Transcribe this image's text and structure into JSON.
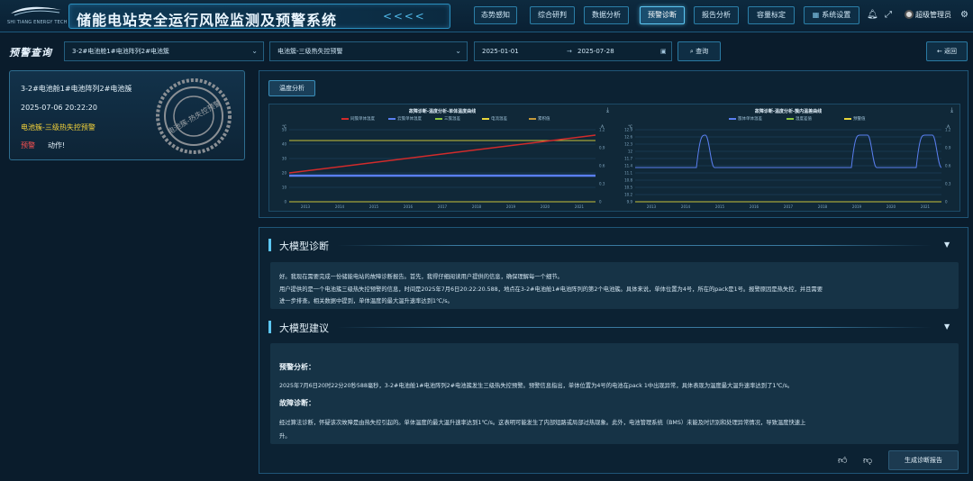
{
  "header": {
    "logo_text": "SHI TIANG ENERGY TECH 石 天 能 源",
    "title": "储能电站安全运行风险监测及预警系统",
    "arrows": "< < < <",
    "nav": [
      "态势感知",
      "综合研判",
      "数据分析",
      "预警诊断",
      "报告分析",
      "容量标定",
      "系统设置"
    ],
    "active_nav": "预警诊断",
    "user": "超级管理员"
  },
  "query": {
    "title": "预警查询",
    "target_select": "3-2#电池舱1#电池阵列2#电池簇",
    "warning_select": "电池簇-三级热失控预警",
    "date_start": "2025-01-01",
    "date_arrow": "→",
    "date_end": "2025-07-28",
    "search_label": "查询",
    "back_label": "返回"
  },
  "warning_card": {
    "location": "3-2#电池舱1#电池阵列2#电池簇",
    "time": "2025-07-06 20:22:20",
    "type": "电池簇-三级热失控预警",
    "level": "预警",
    "status": "动作!",
    "stamp_text": "电池簇-热失控预警"
  },
  "analysis": {
    "tab": "温度分析",
    "charts": [
      {
        "title": "故障诊断-温度分析-单体温度曲线",
        "left_unit": "℃",
        "right_unit": "A",
        "legend": [
          "同簇单体温度",
          "云簇单体温度",
          "三簇温差",
          "电流温差",
          "累积值"
        ],
        "legend_colors": [
          "#d22b2b",
          "#5a7ff0",
          "#8cc63f",
          "#e8d53a",
          "#c49a3a"
        ],
        "y_ticks": [
          "0",
          "10",
          "20",
          "30",
          "40",
          "50"
        ],
        "y2_ticks": [
          "0",
          "0.3",
          "0.6",
          "0.9",
          "1.2"
        ],
        "x_ticks": [
          "2013",
          "2014",
          "2015",
          "2016",
          "2017",
          "2018",
          "2019",
          "2020",
          "2021"
        ]
      },
      {
        "title": "故障诊断-温度分析-簇内温差曲线",
        "left_unit": "℃",
        "right_unit": "A",
        "legend": [
          "簇体单体温差",
          "温度差值",
          "预警值"
        ],
        "legend_colors": [
          "#5a7ff0",
          "#8cc63f",
          "#e8d53a"
        ],
        "y_ticks": [
          "9.9",
          "10.2",
          "10.5",
          "10.8",
          "11.1",
          "11.4",
          "11.7",
          "12",
          "12.3",
          "12.6",
          "12.9"
        ],
        "y2_ticks": [
          "0",
          "0.3",
          "0.6",
          "0.9",
          "1.2"
        ],
        "x_ticks": [
          "2013",
          "2014",
          "2015",
          "2016",
          "2017",
          "2018",
          "2019",
          "2020",
          "2021"
        ]
      }
    ]
  },
  "llm": {
    "diagnosis_title": "大模型诊断",
    "diagnosis_lines": [
      "好。我现在需要完成一份储能电站的故障诊断报告。首先，我得仔细阅读用户提供的信息，确保理解每一个细节。",
      "用户提供的是一个电池簇三级热失控预警的信息，时间是2025年7月6日20:22:20.588，地点在3-2#电池舱1#电池阵列的第2个电池簇。具体来说，单体位置为4号，所在的pack是1号。报警原因是热失控，并且需要",
      "进一步排查。相关数据中提到，单体温度的最大温升速率达到1℃/s。"
    ],
    "advice_title": "大模型建议",
    "analysis_heading": "预警分析：",
    "analysis_text": "2025年7月6日20时22分20秒588毫秒，3-2#电池舱1#电池阵列2#电池簇发生三级热失控预警。预警信息指出，单体位置为4号的电池在pack 1中出现异常，具体表现为温度最大温升速率达到了1℃/s。",
    "fault_heading": "故障诊断：",
    "fault_text_1": "经过算法诊断，怀疑该次故障是由热失控引起的。单体温度的最大温升速率达到1℃/s。这表明可能发生了内部短路或局部过热现象。此外，电池管理系统（BMS）未能及时识别和处理异常情况，导致温度快速上",
    "fault_text_2": "升。",
    "generate_label": "生成诊断报告"
  }
}
